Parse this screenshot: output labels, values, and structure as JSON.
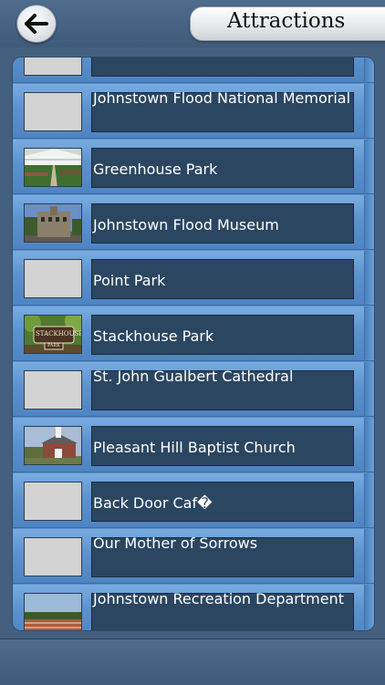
{
  "header": {
    "back_icon": "back-arrow-icon",
    "title": "Attractions"
  },
  "attractions": [
    {
      "name": "",
      "thumb": "placeholder"
    },
    {
      "name": "Johnstown Flood National Memorial",
      "thumb": "placeholder"
    },
    {
      "name": "Greenhouse Park",
      "thumb": "greenhouse-photo"
    },
    {
      "name": "Johnstown Flood Museum",
      "thumb": "museum-photo"
    },
    {
      "name": "Point Park",
      "thumb": "placeholder"
    },
    {
      "name": "Stackhouse Park",
      "thumb": "stackhouse-sign-photo"
    },
    {
      "name": "St. John Gualbert Cathedral",
      "thumb": "placeholder"
    },
    {
      "name": "Pleasant Hill Baptist Church",
      "thumb": "church-photo"
    },
    {
      "name": "Back Door Caf�",
      "thumb": "placeholder"
    },
    {
      "name": "Our Mother of Sorrows",
      "thumb": "placeholder"
    },
    {
      "name": "Johnstown Recreation Department",
      "thumb": "recreation-photo"
    }
  ],
  "stackhouse_sign": {
    "line1": "STACKHOUSE",
    "line2": "PARK"
  }
}
